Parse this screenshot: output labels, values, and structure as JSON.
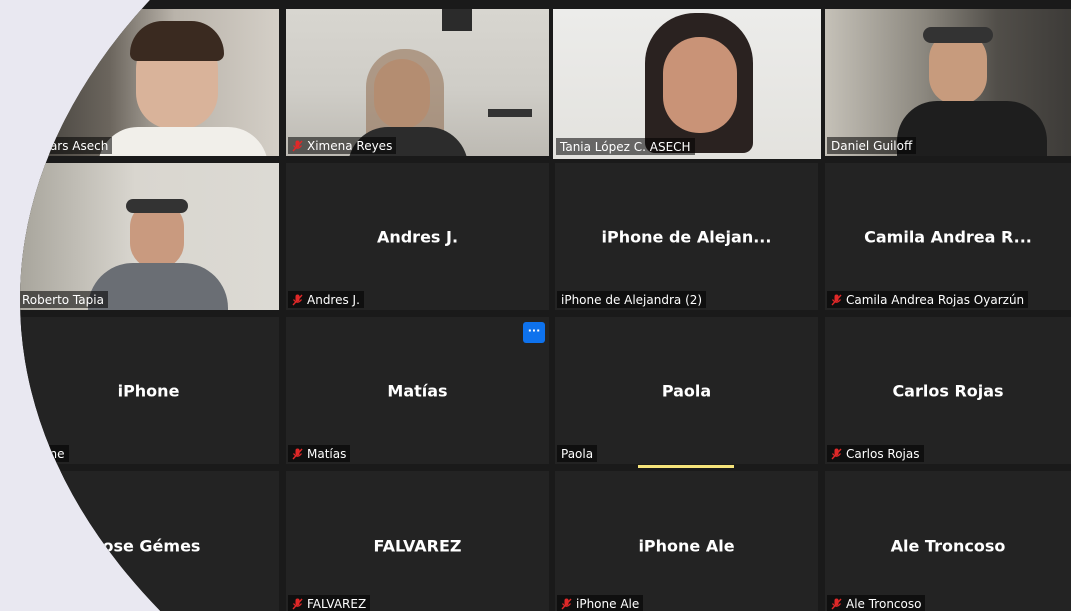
{
  "participants": [
    {
      "name": "Webinars Asech",
      "label": "ebinars Asech",
      "video": true,
      "muted": false
    },
    {
      "name": "Ximena Reyes",
      "label": "Ximena Reyes",
      "video": true,
      "muted": true
    },
    {
      "name": "Tania López C. ASECH",
      "label": "Tania López C. ASECH",
      "video": true,
      "muted": false,
      "active_speaker": true
    },
    {
      "name": "Daniel Guiloff",
      "label": "Daniel Guiloff",
      "video": true,
      "muted": false
    },
    {
      "name": "Roberto Tapia",
      "label": "Roberto Tapia",
      "video": true,
      "muted": false
    },
    {
      "display": "Andres J.",
      "label": "Andres J.",
      "video": false,
      "muted": true
    },
    {
      "display": "iPhone de Alejan...",
      "label": "iPhone de Alejandra (2)",
      "video": false,
      "muted": false
    },
    {
      "display": "Camila Andrea R...",
      "label": "Camila Andrea Rojas Oyarzún",
      "video": false,
      "muted": true
    },
    {
      "display": "iPhone",
      "label": "iPhone",
      "video": false,
      "muted": false
    },
    {
      "display": "Matías",
      "label": "Matías",
      "video": false,
      "muted": true
    },
    {
      "display": "Paola",
      "label": "Paola",
      "video": false,
      "muted": false
    },
    {
      "display": "Carlos Rojas",
      "label": "Carlos Rojas",
      "video": false,
      "muted": true
    },
    {
      "display": "Jose Gémes",
      "label": "",
      "video": false,
      "muted": false
    },
    {
      "display": "FALVAREZ",
      "label": "FALVAREZ",
      "video": false,
      "muted": true
    },
    {
      "display": "iPhone Ale",
      "label": "iPhone Ale",
      "video": false,
      "muted": true
    },
    {
      "display": "Ale Troncoso",
      "label": "Ale Troncoso",
      "video": false,
      "muted": true
    }
  ],
  "more_button": {
    "icon": "more-dots-icon",
    "glyph": "···"
  },
  "colors": {
    "active_speaker_border": "#b6e257",
    "more_button": "#0e72ed",
    "speaking_bar": "#f5e37a",
    "mute_icon": "#e02828"
  }
}
